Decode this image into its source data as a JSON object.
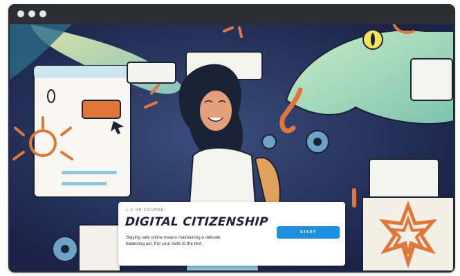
{
  "window": {
    "controls": [
      "dot",
      "dot",
      "dot"
    ]
  },
  "hero": {
    "illustration_icon": "digital-citizenship-illustration",
    "colors": {
      "background": "#1f2a4f",
      "accent": "#1e8fdc",
      "snake": "#a8d6b6",
      "orange": "#e0763a"
    }
  },
  "course": {
    "tag": "1-2 HR COURSE",
    "title": "DIGITAL CITIZENSHIP",
    "description": "Staying safe online means maintaining a delicate balancing act. Put your skills to the test.",
    "start_label": "START"
  }
}
